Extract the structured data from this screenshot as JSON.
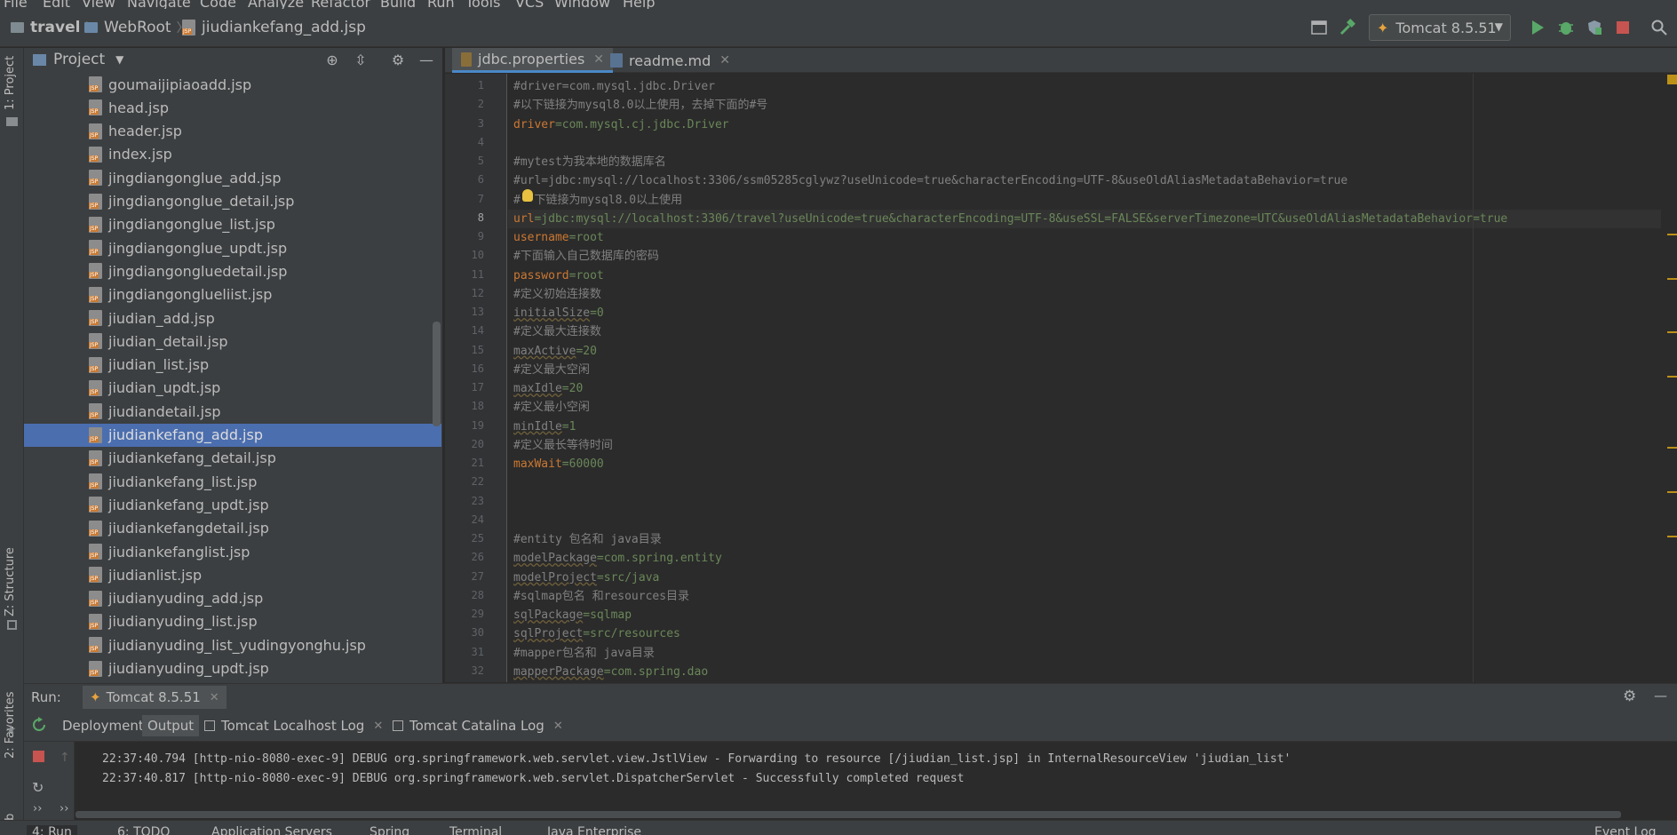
{
  "menubar": {
    "items": [
      "File",
      "Edit",
      "View",
      "Navigate",
      "Code",
      "Analyze",
      "Refactor",
      "Build",
      "Run",
      "Tools",
      "VCS",
      "Window",
      "Help"
    ]
  },
  "navbar": {
    "breadcrumbs": [
      "travel",
      "WebRoot",
      "jiudiankefang_add.jsp"
    ],
    "run_config": "Tomcat 8.5.51"
  },
  "left_strip": {
    "project_tab": "1: Project",
    "structure_tab": "Z: Structure",
    "favorites_tab": "2: Favorites",
    "web_tab": "Web"
  },
  "project_panel": {
    "title": "Project",
    "files": [
      "goumaijipiaoadd.jsp",
      "head.jsp",
      "header.jsp",
      "index.jsp",
      "jingdiangonglue_add.jsp",
      "jingdiangonglue_detail.jsp",
      "jingdiangonglue_list.jsp",
      "jingdiangonglue_updt.jsp",
      "jingdiangongluedetail.jsp",
      "jingdiangonglueliist.jsp",
      "jiudian_add.jsp",
      "jiudian_detail.jsp",
      "jiudian_list.jsp",
      "jiudian_updt.jsp",
      "jiudiandetail.jsp",
      "jiudiankefang_add.jsp",
      "jiudiankefang_detail.jsp",
      "jiudiankefang_list.jsp",
      "jiudiankefang_updt.jsp",
      "jiudiankefangdetail.jsp",
      "jiudiankefanglist.jsp",
      "jiudianlist.jsp",
      "jiudianyuding_add.jsp",
      "jiudianyuding_list.jsp",
      "jiudianyuding_list_yudingyonghu.jsp",
      "jiudianyuding_updt.jsp"
    ],
    "selected_index": 15
  },
  "editor": {
    "tabs": [
      {
        "label": "jdbc.properties",
        "active": true
      },
      {
        "label": "readme.md",
        "active": false
      }
    ],
    "current_line": 8,
    "lines": [
      {
        "n": "1",
        "k": "",
        "v": "",
        "c": "#driver=com.mysql.jdbc.Driver"
      },
      {
        "n": "2",
        "k": "",
        "v": "",
        "c": "#以下链接为mysql8.0以上使用，去掉下面的#号"
      },
      {
        "n": "3",
        "k": "driver",
        "v": "=com.mysql.cj.jdbc.Driver",
        "c": ""
      },
      {
        "n": "4",
        "k": "",
        "v": "",
        "c": ""
      },
      {
        "n": "5",
        "k": "",
        "v": "",
        "c": "#mytest为我本地的数据库名"
      },
      {
        "n": "6",
        "k": "",
        "v": "",
        "c": "#url=jdbc:mysql://localhost:3306/ssm05285cglywz?useUnicode=true&characterEncoding=UTF-8&useOldAliasMetadataBehavior=true"
      },
      {
        "n": "7",
        "k": "",
        "v": "",
        "c": "#  下链接为mysql8.0以上使用"
      },
      {
        "n": "8",
        "k": "url",
        "v": "=jdbc:mysql://localhost:3306/travel?useUnicode=true&characterEncoding=UTF-8&useSSL=FALSE&serverTimezone=UTC&useOldAliasMetadataBehavior=true",
        "c": ""
      },
      {
        "n": "9",
        "k": "username",
        "v": "=root",
        "c": ""
      },
      {
        "n": "10",
        "k": "",
        "v": "",
        "c": "#下面输入自己数据库的密码"
      },
      {
        "n": "11",
        "k": "password",
        "v": "=root",
        "c": ""
      },
      {
        "n": "12",
        "k": "",
        "v": "",
        "c": "#定义初始连接数"
      },
      {
        "n": "13",
        "k2": "initialSize",
        "v": "=0",
        "c": ""
      },
      {
        "n": "14",
        "k": "",
        "v": "",
        "c": "#定义最大连接数"
      },
      {
        "n": "15",
        "k2": "maxActive",
        "v": "=20",
        "c": ""
      },
      {
        "n": "16",
        "k": "",
        "v": "",
        "c": "#定义最大空闲"
      },
      {
        "n": "17",
        "k2": "maxIdle",
        "v": "=20",
        "c": ""
      },
      {
        "n": "18",
        "k": "",
        "v": "",
        "c": "#定义最小空闲"
      },
      {
        "n": "19",
        "k2": "minIdle",
        "v": "=1",
        "c": ""
      },
      {
        "n": "20",
        "k": "",
        "v": "",
        "c": "#定义最长等待时间"
      },
      {
        "n": "21",
        "k": "maxWait",
        "v": "=60000",
        "c": ""
      },
      {
        "n": "22",
        "k": "",
        "v": "",
        "c": ""
      },
      {
        "n": "23",
        "k": "",
        "v": "",
        "c": ""
      },
      {
        "n": "24",
        "k": "",
        "v": "",
        "c": ""
      },
      {
        "n": "25",
        "k": "",
        "v": "",
        "c": "#entity 包名和 java目录"
      },
      {
        "n": "26",
        "k2": "modelPackage",
        "v": "=com.spring.entity",
        "c": ""
      },
      {
        "n": "27",
        "k2": "modelProject",
        "v": "=src/java",
        "c": ""
      },
      {
        "n": "28",
        "k": "",
        "v": "",
        "c": "#sqlmap包名 和resources目录"
      },
      {
        "n": "29",
        "k2": "sqlPackage",
        "v": "=sqlmap",
        "c": ""
      },
      {
        "n": "30",
        "k2": "sqlProject",
        "v": "=src/resources",
        "c": ""
      },
      {
        "n": "31",
        "k": "",
        "v": "",
        "c": "#mapper包名和 java目录"
      },
      {
        "n": "32",
        "k2": "mapperPackage",
        "v": "=com.spring.dao",
        "c": ""
      }
    ]
  },
  "run_panel": {
    "label": "Run:",
    "config_tab": "Tomcat 8.5.51",
    "tabs": [
      "Deployment",
      "Output",
      "Tomcat Localhost Log",
      "Tomcat Catalina Log"
    ],
    "active_tab": "Output",
    "log_lines": [
      "22:37:40.794 [http-nio-8080-exec-9] DEBUG org.springframework.web.servlet.view.JstlView - Forwarding to resource [/jiudian_list.jsp] in InternalResourceView 'jiudian_list'",
      "22:37:40.817 [http-nio-8080-exec-9] DEBUG org.springframework.web.servlet.DispatcherServlet - Successfully completed request"
    ]
  },
  "bottom_bar": {
    "tabs": [
      "4: Run",
      "6: TODO",
      "Application Servers",
      "Spring",
      "Terminal",
      "Java Enterprise"
    ],
    "right": "Event Log"
  },
  "colors": {
    "background": "#2b2b2b",
    "panel": "#3c3f41",
    "selection": "#4b6eaf",
    "keyword": "#cc7832",
    "string": "#6a8759",
    "comment": "#808080"
  }
}
